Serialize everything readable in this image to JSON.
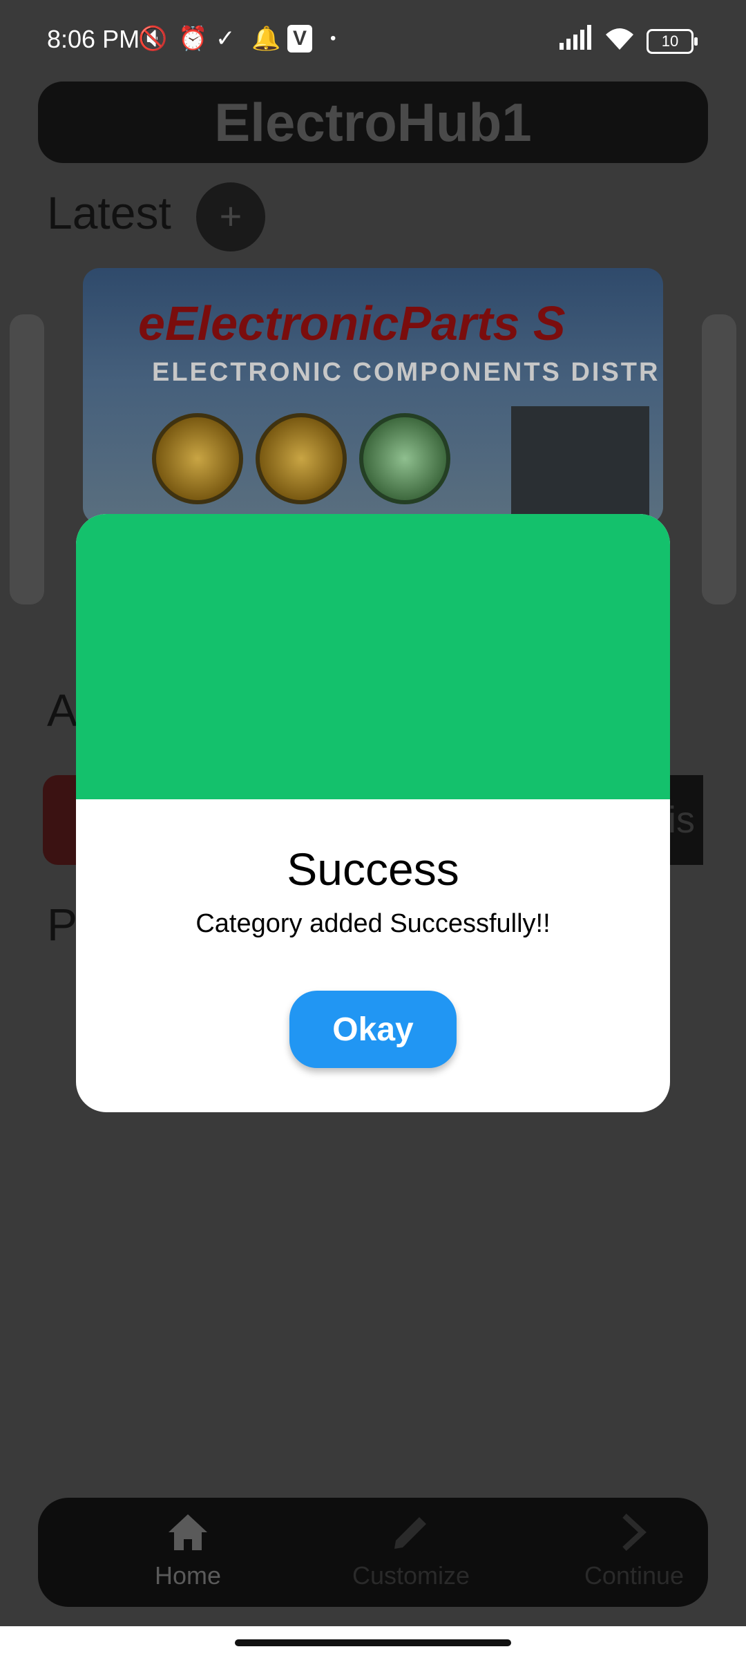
{
  "status_bar": {
    "time": "8:06 PM",
    "icons": [
      "mute-icon",
      "alarm-icon",
      "check-icon",
      "bell-icon",
      "app-v-icon",
      "dot-icon"
    ],
    "right_icons": [
      "signal-icon",
      "wifi-icon",
      "battery-icon"
    ],
    "battery_level": "10"
  },
  "app": {
    "title": "ElectroHub1",
    "latest_label": "Latest",
    "add_label": "+",
    "carousel": {
      "banner_text": "eElectronicParts S",
      "sub_text": "ELECTRONIC COMPONENTS DISTR"
    },
    "section_a_label": "A",
    "section_p_label": "P",
    "category_right_text": "sis"
  },
  "bottom_nav": {
    "items": [
      {
        "label": "Home",
        "icon": "home-icon"
      },
      {
        "label": "Customize",
        "icon": "pencil-icon"
      },
      {
        "label": "Continue",
        "icon": "chevron-right-icon"
      }
    ]
  },
  "dialog": {
    "title": "Success",
    "message": "Category added Successfully!!",
    "button_label": "Okay",
    "header_color": "#14c16c",
    "button_color": "#2196f3"
  }
}
